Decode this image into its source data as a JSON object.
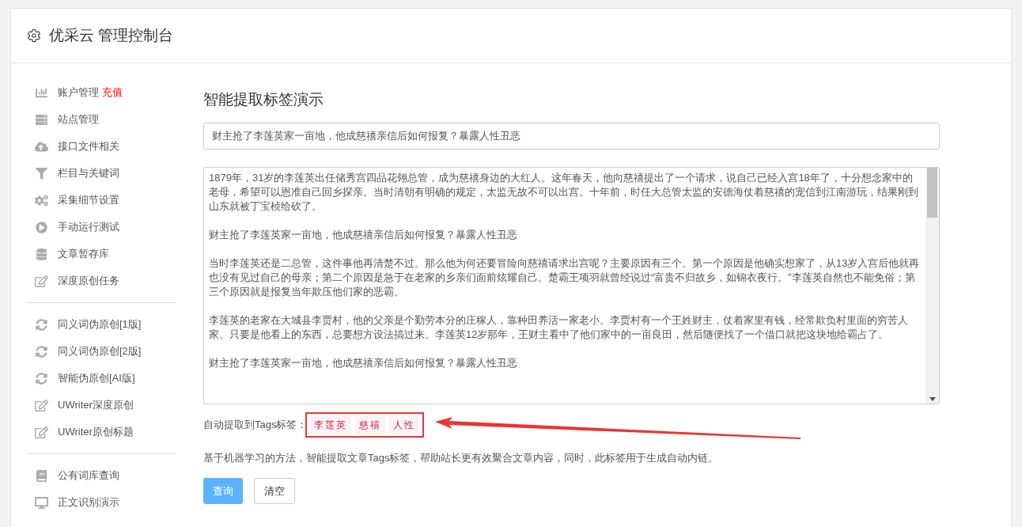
{
  "header": {
    "title": "优采云 管理控制台"
  },
  "sidebar": {
    "sections": [
      {
        "items": [
          {
            "label": "账户管理",
            "badge": "充值"
          },
          {
            "label": "站点管理"
          },
          {
            "label": "接口文件相关"
          },
          {
            "label": "栏目与关键词"
          },
          {
            "label": "采集细节设置"
          },
          {
            "label": "手动运行测试"
          },
          {
            "label": "文章暂存库"
          },
          {
            "label": "深度原创任务"
          }
        ]
      },
      {
        "items": [
          {
            "label": "同义词伪原创[1版]"
          },
          {
            "label": "同义词伪原创[2版]"
          },
          {
            "label": "智能伪原创[AI版]"
          },
          {
            "label": "UWriter深度原创"
          },
          {
            "label": "UWriter原创标题"
          }
        ]
      },
      {
        "items": [
          {
            "label": "公有词库查询"
          },
          {
            "label": "正文识别演示"
          }
        ]
      }
    ]
  },
  "main": {
    "title": "智能提取标签演示",
    "title_field": {
      "value": "财主抢了李莲英家一亩地，他成慈禧亲信后如何报复？暴露人性丑恶"
    },
    "content_field": {
      "paragraphs": [
        "1879年，31岁的李莲英出任储秀宫四品花翎总管，成为慈禧身边的大红人。这年春天，他向慈禧提出了一个请求，说自己已经入宫18年了，十分想念家中的老母，希望可以恩准自己回乡探亲。当时清朝有明确的规定，太监无故不可以出宫。十年前，时任大总管太监的安德海仗着慈禧的宠信到江南游玩，结果刚到山东就被丁宝桢给砍了。",
        "财主抢了李莲英家一亩地，他成慈禧亲信后如何报复？暴露人性丑恶",
        "当时李莲英还是二总管，这件事他再清楚不过。那么他为何还要冒险向慈禧请求出宫呢？主要原因有三个。第一个原因是他确实想家了，从13岁入宫后他就再也没有见过自己的母亲；第二个原因是急于在老家的乡亲们面前炫耀自己。楚霸王项羽就曾经说过“富贵不归故乡，如锦衣夜行。”李莲英自然也不能免俗；第三个原因就是报复当年欺压他们家的恶霸。",
        "李莲英的老家在大城县李贾村，他的父亲是个勤劳本分的庄稼人，靠种田养活一家老小。李贾村有一个王姓财主，仗着家里有钱，经常欺负村里面的穷苦人家。只要是他看上的东西，总要想方设法搞过来。李莲英12岁那年，王财主看中了他们家中的一亩良田，然后随便找了一个借口就把这块地给霸占了。",
        "财主抢了李莲英家一亩地，他成慈禧亲信后如何报复？暴露人性丑恶"
      ]
    },
    "tags_label": "自动提取到Tags标签：",
    "tags": [
      "李莲英",
      "慈禧",
      "人性"
    ],
    "description": "基于机器学习的方法，智能提取文章Tags标签，帮助站长更有效聚合文章内容，同时，此标签用于生成自动内链。",
    "buttons": [
      {
        "label": "查询",
        "kind": "primary"
      },
      {
        "label": "清空",
        "kind": "default"
      }
    ]
  }
}
